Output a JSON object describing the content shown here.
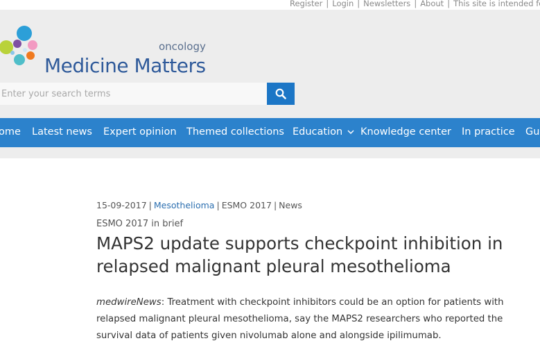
{
  "top_links": {
    "register": "Register",
    "login": "Login",
    "newsletters": "Newsletters",
    "about": "About",
    "notice": "This site is intended for"
  },
  "logo": {
    "main": "Medicine Matters",
    "sub": "oncology"
  },
  "search": {
    "placeholder": "Enter your search terms"
  },
  "nav": {
    "items": [
      "ome",
      "Latest news",
      "Expert opinion",
      "Themed collections",
      "Education",
      "Knowledge center",
      "In practice",
      "Gu"
    ]
  },
  "article": {
    "date": "15-09-2017",
    "topic": "Mesothelioma",
    "event": "ESMO 2017",
    "type": "News",
    "kicker": "ESMO 2017 in brief",
    "title": "MAPS2 update supports checkpoint inhibition in relapsed malignant pleural mesothelioma",
    "source": "medwireNews",
    "lead": ": Treatment with checkpoint inhibitors could be an option for patients with relapsed malignant pleural mesothelioma, say the MAPS2 researchers who reported the survival data of patients given nivolumab alone and alongside ipilimumab."
  },
  "colors": {
    "nav_bg": "#2c82cc",
    "search_button": "#1c76c6",
    "logo_text": "#2f5a9a",
    "link": "#2c6fb0"
  }
}
